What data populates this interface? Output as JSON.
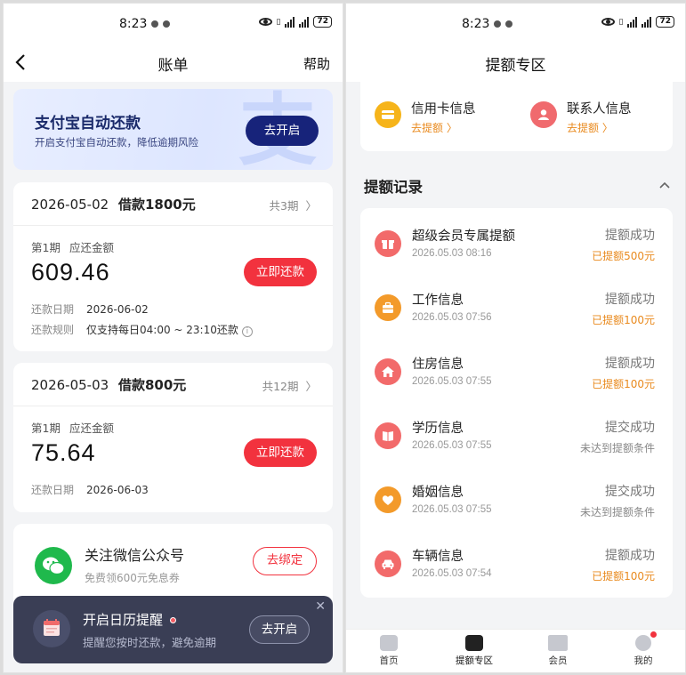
{
  "left": {
    "status": {
      "time": "8:23",
      "battery": "72"
    },
    "nav": {
      "title": "账单",
      "help": "帮助"
    },
    "banner": {
      "title": "支付宝自动还款",
      "subtitle": "开启支付宝自动还款，降低逾期风险",
      "button": "去开启",
      "watermark": "支"
    },
    "loans": [
      {
        "date": "2026-05-02",
        "desc": "借款1800元",
        "count": "共3期",
        "period": "第1期",
        "due_label": "应还金额",
        "amount": "609.46",
        "button": "立即还款",
        "repay_date_label": "还款日期",
        "repay_date": "2026-06-02",
        "rule_label": "还款规则",
        "rule": "仅支持每日04:00 ~ 23:10还款"
      },
      {
        "date": "2026-05-03",
        "desc": "借款800元",
        "count": "共12期",
        "period": "第1期",
        "due_label": "应还金额",
        "amount": "75.64",
        "button": "立即还款",
        "repay_date_label": "还款日期",
        "repay_date": "2026-06-03"
      }
    ],
    "wechat": {
      "title": "关注微信公众号",
      "subtitle": "免费领600元免息券",
      "button": "去绑定"
    },
    "toast": {
      "title": "开启日历提醒",
      "subtitle": "提醒您按时还款，避免逾期",
      "button": "去开启",
      "close": "✕"
    }
  },
  "right": {
    "status": {
      "time": "8:23",
      "battery": "72"
    },
    "nav": {
      "title": "提额专区"
    },
    "quick": [
      {
        "title": "信用卡信息",
        "link": "去提额 〉"
      },
      {
        "title": "联系人信息",
        "link": "去提额 〉"
      }
    ],
    "records_header": "提额记录",
    "records": [
      {
        "title": "超级会员专属提额",
        "date": "2026.05.03 08:16",
        "status": "提额成功",
        "result": "已提额500元",
        "result_type": "orange"
      },
      {
        "title": "工作信息",
        "date": "2026.05.03 07:56",
        "status": "提额成功",
        "result": "已提额100元",
        "result_type": "orange"
      },
      {
        "title": "住房信息",
        "date": "2026.05.03 07:55",
        "status": "提额成功",
        "result": "已提额100元",
        "result_type": "orange"
      },
      {
        "title": "学历信息",
        "date": "2026.05.03 07:55",
        "status": "提交成功",
        "result": "未达到提额条件",
        "result_type": "grey"
      },
      {
        "title": "婚姻信息",
        "date": "2026.05.03 07:55",
        "status": "提交成功",
        "result": "未达到提额条件",
        "result_type": "grey"
      },
      {
        "title": "车辆信息",
        "date": "2026.05.03 07:54",
        "status": "提额成功",
        "result": "已提额100元",
        "result_type": "orange"
      }
    ],
    "tabs": [
      {
        "label": "首页"
      },
      {
        "label": "提额专区"
      },
      {
        "label": "会员"
      },
      {
        "label": "我的"
      }
    ]
  },
  "colors": {
    "accent_red": "#f2323e",
    "brand_navy": "#17237a",
    "orange": "#e98a1e",
    "wechat_green": "#1fb94c"
  }
}
